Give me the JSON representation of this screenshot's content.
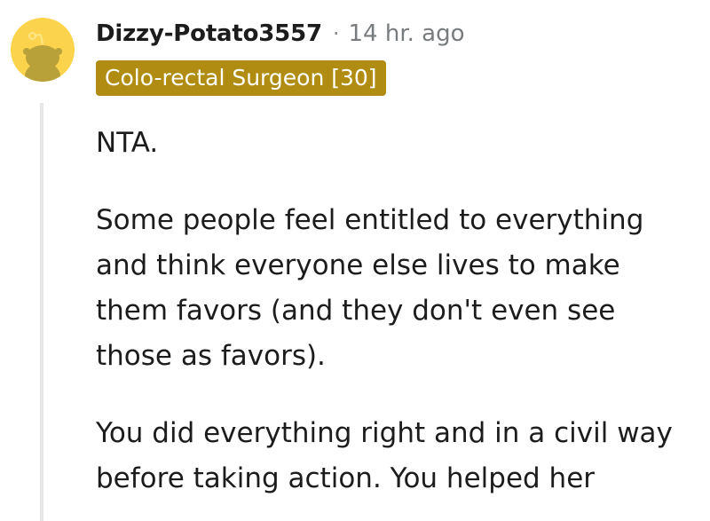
{
  "comment": {
    "author": "Dizzy-Potato3557",
    "separator": "·",
    "timestamp": "14 hr. ago",
    "flair": "Colo-rectal Surgeon [30]",
    "avatar_icon": "snoo-avatar-icon",
    "avatar_color": "#fcd34d",
    "flair_color": "#b08d12",
    "paragraphs": [
      "NTA.",
      "Some people feel entitled to everything and think everyone else lives to make them favors (and they don't even see those as favors).",
      "You did everything right and in a civil way before taking action. You helped her"
    ]
  }
}
